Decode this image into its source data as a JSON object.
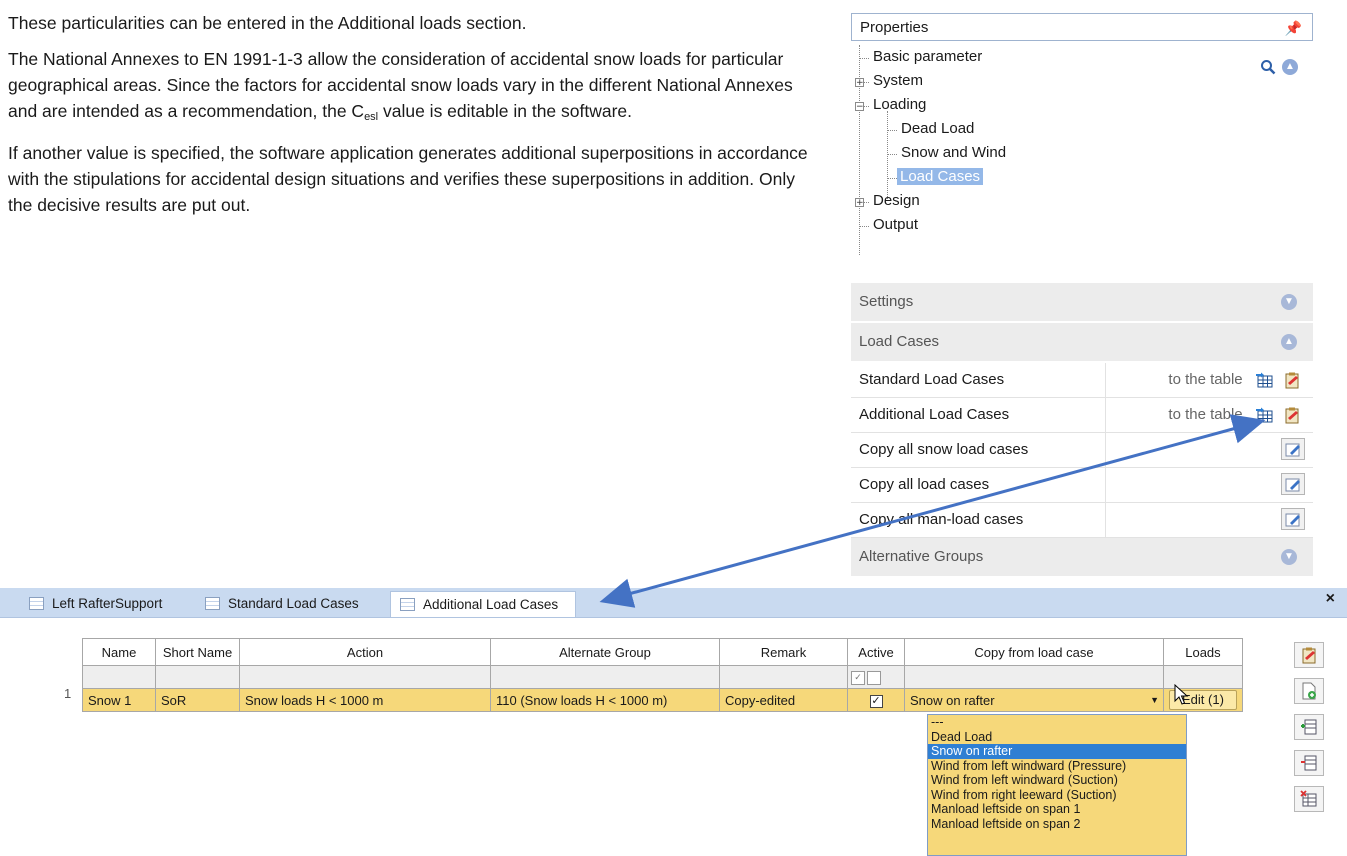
{
  "document": {
    "para1": "These particularities can be entered in the Additional loads section.",
    "para2_part1": "The National Annexes to EN 1991-1-3 allow the consideration of accidental snow loads for particular geographical areas. Since the factors for accidental snow loads vary in the different National Annexes and are intended as a recommendation, the C",
    "para2_sub": "esl",
    "para2_part2": " value is editable in the software.",
    "para3": "If another value is specified, the software application generates additional superpositions in accordance with the stipulations for accidental design situations and verifies these superpositions in addition. Only the decisive results are put out."
  },
  "properties": {
    "title": "Properties",
    "tree": {
      "basic": "Basic parameter",
      "system": "System",
      "loading": "Loading",
      "dead_load": "Dead Load",
      "snow_wind": "Snow and Wind",
      "load_cases": "Load Cases",
      "design": "Design",
      "output": "Output"
    }
  },
  "settings_panel": {
    "settings": "Settings",
    "load_cases": "Load Cases",
    "rows": [
      {
        "label": "Standard Load Cases",
        "link": "to the table"
      },
      {
        "label": "Additional Load Cases",
        "link": "to the table"
      },
      {
        "label": "Copy all snow load cases"
      },
      {
        "label": "Copy all load cases"
      },
      {
        "label": "Copy all man-load cases"
      }
    ],
    "alternative_groups": "Alternative Groups"
  },
  "tabs": {
    "tab1": "Left RafterSupport",
    "tab2": "Standard Load Cases",
    "tab3": "Additional Load Cases",
    "close": "×"
  },
  "table": {
    "headers": {
      "name": "Name",
      "short": "Short Name",
      "action": "Action",
      "group": "Alternate Group",
      "remark": "Remark",
      "active": "Active",
      "copy": "Copy from load case",
      "loads": "Loads"
    },
    "row": {
      "num": "1",
      "name": "Snow 1",
      "short": "SoR",
      "action": "Snow loads H < 1000 m",
      "group": "110 (Snow loads H < 1000 m)",
      "remark": "Copy-edited",
      "active_check": "✓",
      "copy": "Snow on rafter",
      "loads": "Edit (1)"
    },
    "dropdown": [
      "---",
      "Dead Load",
      "Snow on rafter",
      "Wind from left windward (Pressure)",
      "Wind from left windward (Suction)",
      "Wind from right leeward (Suction)",
      "Manload  leftside on span 1",
      "Manload  leftside on span 2"
    ]
  },
  "colors": {
    "accent": "#4472c4",
    "row_highlight": "#f6d87a",
    "tab_strip": "#c9daf0"
  }
}
